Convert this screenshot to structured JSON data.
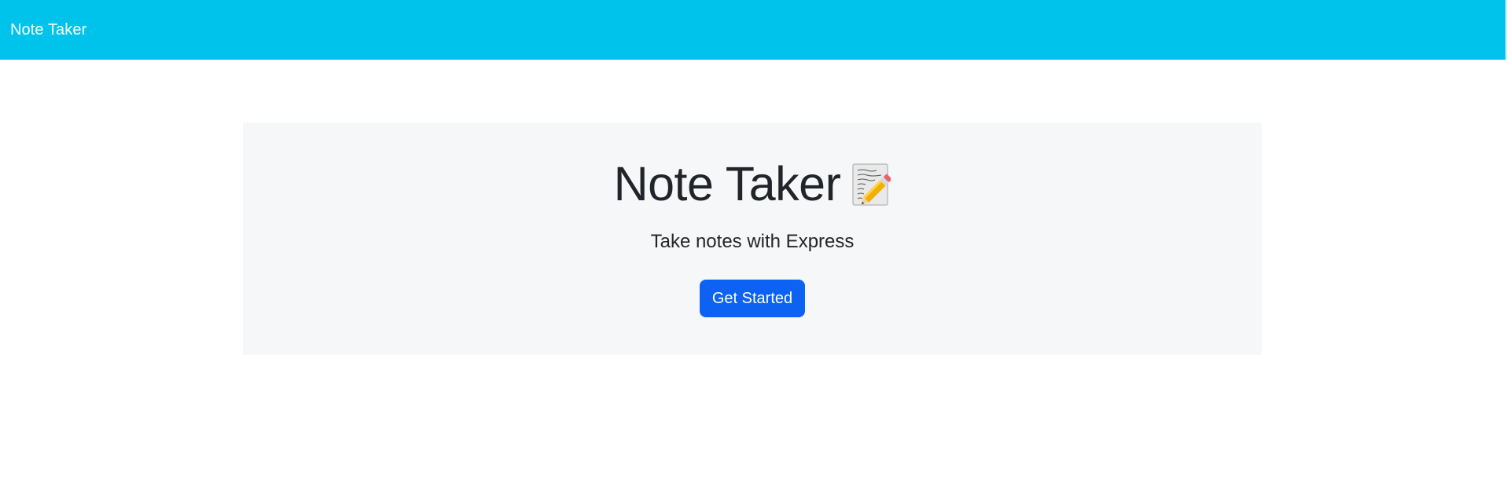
{
  "navbar": {
    "brand": "Note Taker",
    "background_color": "#00c3ec"
  },
  "hero": {
    "title": "Note Taker",
    "title_icon": "memo-icon",
    "lead": "Take notes with Express",
    "cta_label": "Get Started",
    "cta_color": "#0d62f4",
    "panel_color": "#f6f7f9"
  }
}
